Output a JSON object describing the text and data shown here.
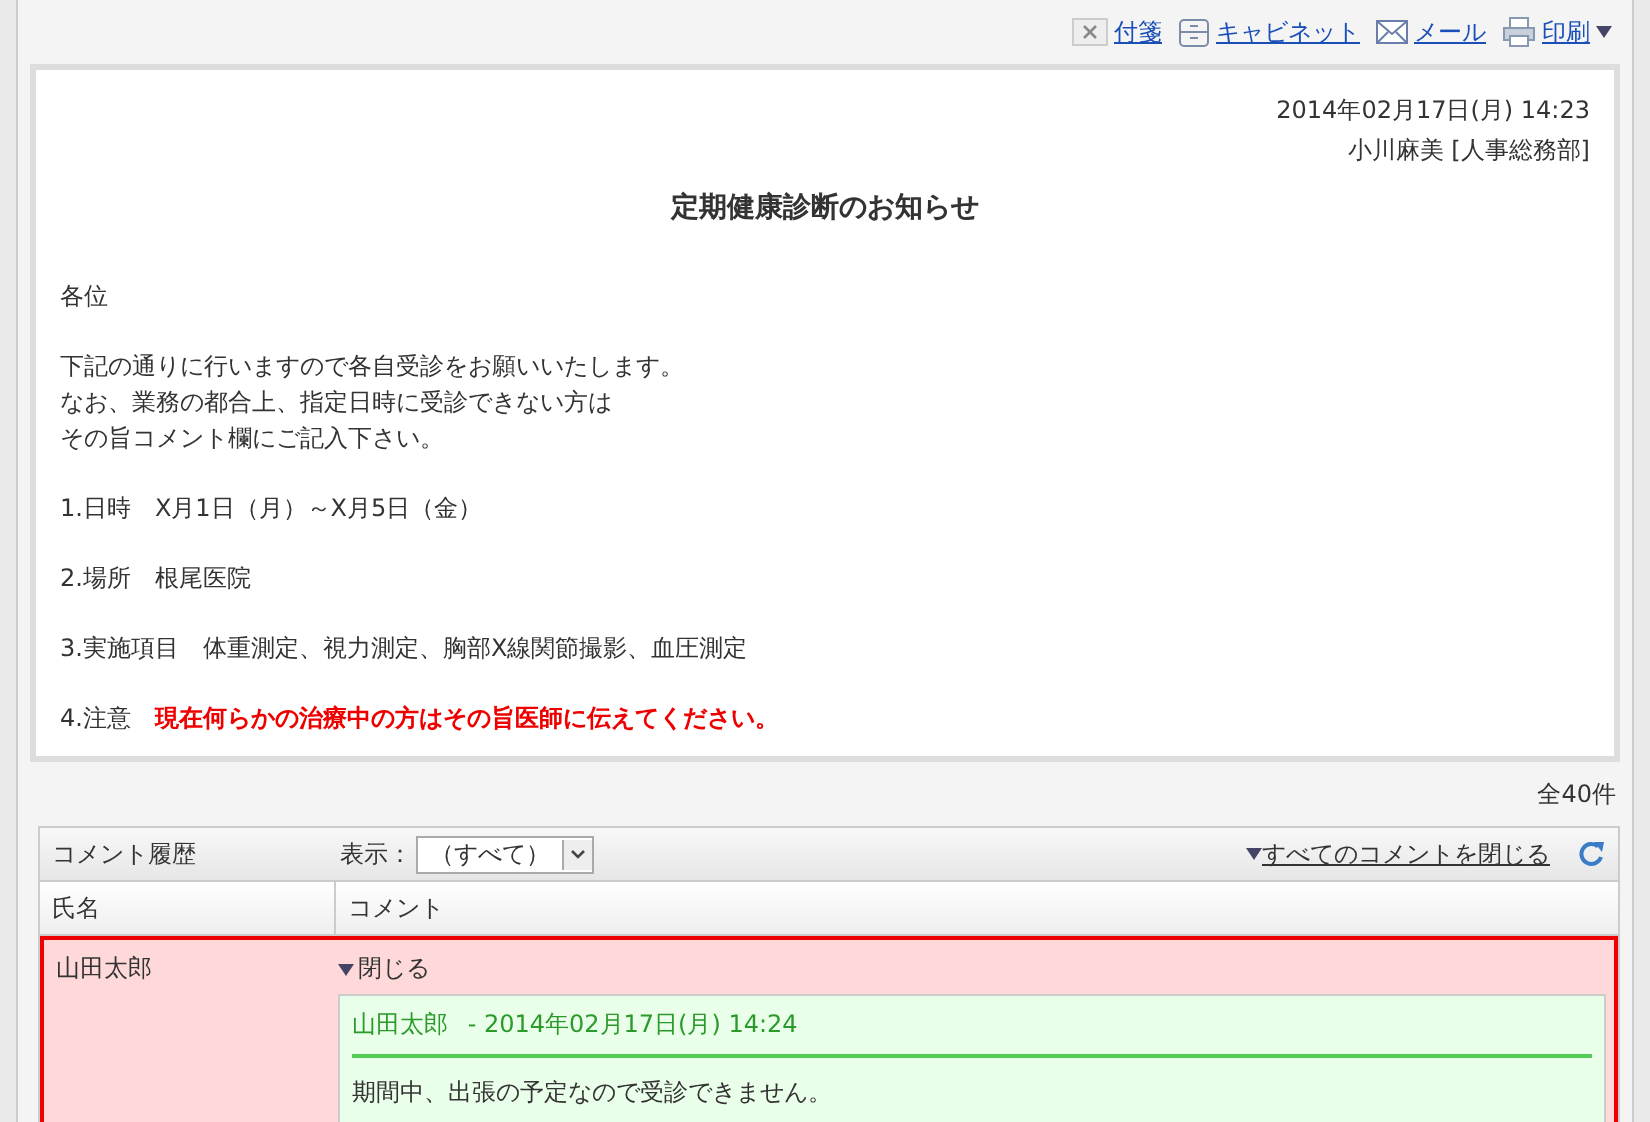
{
  "toolbar": [
    {
      "kind": "sticky",
      "label": "付箋"
    },
    {
      "kind": "cabinet",
      "label": "キャビネット"
    },
    {
      "kind": "mail",
      "label": "メール"
    },
    {
      "kind": "print",
      "label": "印刷",
      "dropdown": true
    }
  ],
  "message": {
    "date": "2014年02月17日(月) 14:23",
    "author": "小川麻美 [人事総務部]",
    "title": "定期健康診断のお知らせ",
    "paragraphs": [
      {
        "kind": "text",
        "lines": [
          "各位"
        ]
      },
      {
        "kind": "text",
        "lines": [
          "下記の通りに行いますので各自受診をお願いいたします。",
          "なお、業務の都合上、指定日時に受診できない方は",
          "その旨コメント欄にご記入下さい。"
        ]
      },
      {
        "kind": "text",
        "lines": [
          "1.日時　X月1日（月）～X月5日（金）"
        ]
      },
      {
        "kind": "text",
        "lines": [
          "2.場所　根尾医院"
        ]
      },
      {
        "kind": "text",
        "lines": [
          "3.実施項目　体重測定、視力測定、胸部X線関節撮影、血圧測定"
        ]
      },
      {
        "kind": "notice",
        "label": "4.注意",
        "text": "現在何らかの治療中の方はその旨医師に伝えてください。"
      }
    ]
  },
  "count": "全40件",
  "comments": {
    "title": "コメント履歴",
    "filter_label": "表示：",
    "filter_value": "（すべて）",
    "collapse_all": "すべてのコメントを閉じる",
    "columns": [
      "氏名",
      "コメント"
    ],
    "rows": [
      {
        "name": "山田太郎",
        "selected": true,
        "toggle": "閉じる",
        "expanded": true,
        "comment": {
          "author": "山田太郎",
          "date": "- 2014年02月17日(月) 14:24",
          "lines": [
            "期間中、出張の予定なので受診できません。"
          ]
        }
      }
    ]
  }
}
